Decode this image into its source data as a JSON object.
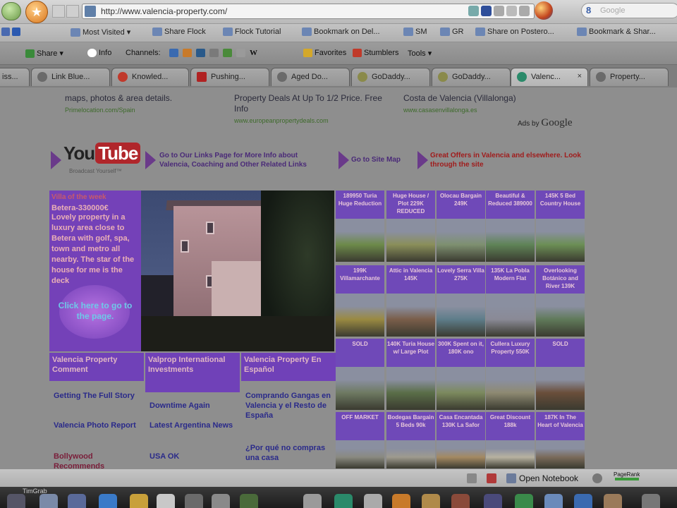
{
  "browser": {
    "url": "http://www.valencia-property.com/",
    "search_placeholder": "Google",
    "search_icon_letter": "8"
  },
  "bookmarks": [
    {
      "label": "Most Visited ▾",
      "icon": "folder-icon"
    },
    {
      "label": "Share Flock",
      "icon": "flock-icon"
    },
    {
      "label": "Flock Tutorial",
      "icon": "flock-icon"
    },
    {
      "label": "Bookmark on Del...",
      "icon": "delicious-icon"
    },
    {
      "label": "SM",
      "icon": "page-icon"
    },
    {
      "label": "GR",
      "icon": "page-icon"
    },
    {
      "label": "Share on Posterо...",
      "icon": "page-icon"
    },
    {
      "label": "Bookmark & Shar...",
      "icon": "page-icon"
    }
  ],
  "toolbar": {
    "share": "Share ▾",
    "info": "Info",
    "channels": "Channels:",
    "favorites": "Favorites",
    "stumblers": "Stumblers",
    "tools": "Tools ▾"
  },
  "tabs": [
    {
      "label": "iss..."
    },
    {
      "label": "Link Blue..."
    },
    {
      "label": "Knowled..."
    },
    {
      "label": "Pushing..."
    },
    {
      "label": "Aged Do..."
    },
    {
      "label": "GoDaddy..."
    },
    {
      "label": "GoDaddy..."
    },
    {
      "label": "Valenc...",
      "close": "×"
    },
    {
      "label": "Property..."
    }
  ],
  "ads": [
    {
      "text": "maps, photos & area details.",
      "url": "Primelocation.com/Spain"
    },
    {
      "text": "Property Deals At Up To 1/2 Price. Free Info",
      "url": "www.europeanpropertydeals.com"
    },
    {
      "text": "Costa de Valencia (Villalonga)",
      "url": "www.casasenvillalonga.es"
    }
  ],
  "ads_by": "Ads by",
  "ads_by_brand": "Google",
  "youtube": {
    "you": "You",
    "tube": "Tube",
    "tagline": "Broadcast Yourself™"
  },
  "links": {
    "links_page": "Go to Our Links Page for More Info about Valencia, Coaching and Other Related Links",
    "site_map": "Go to Site Map",
    "great_offers": "Great Offers in Valencia and elsewhere. Look through the site"
  },
  "feature": {
    "kicker": "Villa of the week",
    "title": "Betera-330000€",
    "description": "Lovely property in a luxury area close to Betera with golf, spa, town and metro all nearby. The star of the house for me is the deck",
    "cta": "Click here to go to the page."
  },
  "grid": [
    {
      "label": "189950 Turia Huge Reduction",
      "thumb": "#6d8a4a"
    },
    {
      "label": "Huge House / Plot 229K REDUCED",
      "thumb": "#8a8f5a"
    },
    {
      "label": "Olocau Bargain 249K",
      "thumb": "#7e9070"
    },
    {
      "label": "Beautiful & Reduced 389000",
      "thumb": "#5f8457"
    },
    {
      "label": "145K 5 Bed Country House",
      "thumb": "#6c8f55"
    },
    {
      "label": "199K Villamarchante",
      "thumb": "#9a8a42"
    },
    {
      "label": "Attic in Valencia 145K",
      "thumb": "#7a5e4a"
    },
    {
      "label": "Lovely Serra Villa 275K",
      "thumb": "#5e7d8a"
    },
    {
      "label": "135K La Pobla Modern Flat",
      "thumb": "#8a8a96"
    },
    {
      "label": "Overlooking Botánico and River 139K",
      "thumb": "#607a5a"
    },
    {
      "label": "SOLD",
      "thumb": "#6e7a62"
    },
    {
      "label": "140K Turia House w/ Large Plot",
      "thumb": "#5a6e48"
    },
    {
      "label": "300K Spent on it, 180K ono",
      "thumb": "#7c8a5e"
    },
    {
      "label": "Cullera Luxury Property 550K",
      "thumb": "#8e8a72"
    },
    {
      "label": "SOLD",
      "thumb": "#6a4e3a"
    },
    {
      "label": "OFF MARKET",
      "thumb": "#8a8a80"
    },
    {
      "label": "Bodegas Bargain 5 Beds 90k",
      "thumb": "#9e9a8e"
    },
    {
      "label": "Casa Encantada 130K La Safor",
      "thumb": "#a48a62"
    },
    {
      "label": "Great Discount 188k",
      "thumb": "#b8b2a0"
    },
    {
      "label": "187K In The Heart of Valencia",
      "thumb": "#7a6a5a"
    }
  ],
  "columns": [
    {
      "heading": "Valencia Property Comment",
      "items": [
        "Getting The Full Story",
        "Valencia Photo Report",
        "Bollywood Recommends"
      ]
    },
    {
      "heading": "Valprop International Investments",
      "items": [
        "Downtime Again",
        "Latest Argentina News",
        "USA OK"
      ]
    },
    {
      "heading": "Valencia Property En Español",
      "items": [
        "Comprando Gangas en Valencia y el Resto de España",
        "¿Por qué no compras una casa"
      ]
    }
  ],
  "statusbar": {
    "open_notebook": "Open Notebook",
    "pagerank": "PageRank"
  },
  "dock": {
    "label": "TimGrab"
  },
  "colors": {
    "purple": "#7441b8",
    "link_blue": "#2a2a8a",
    "offer_red": "#a01c1c"
  }
}
